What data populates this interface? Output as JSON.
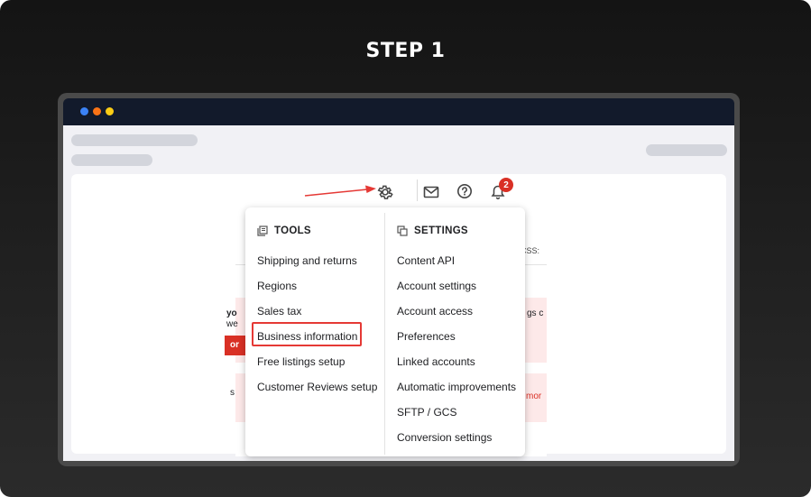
{
  "step": {
    "title": "STEP 1"
  },
  "browser": {
    "dots": [
      {
        "name": "close",
        "color": "#3b82f6"
      },
      {
        "name": "minimize",
        "color": "#f97316"
      },
      {
        "name": "maximize",
        "color": "#facc15"
      }
    ]
  },
  "toolbar": {
    "icons": [
      "gear-icon",
      "mail-icon",
      "help-icon",
      "bell-icon"
    ],
    "notification_count": "2",
    "annotation_color": "#e53935"
  },
  "background_page": {
    "fragment_css": "CSS:",
    "fragment_yo": "yo",
    "fragment_we": "we",
    "fragment_or": "or",
    "fragment_gs": "gs c",
    "fragment_st": "s",
    "fragment_mor": "mor"
  },
  "menu": {
    "tools": {
      "heading": "TOOLS",
      "items": [
        "Shipping and returns",
        "Regions",
        "Sales tax",
        "Business information",
        "Free listings setup",
        "Customer Reviews setup"
      ],
      "highlighted": "Business information"
    },
    "settings": {
      "heading": "SETTINGS",
      "items": [
        "Content API",
        "Account settings",
        "Account access",
        "Preferences",
        "Linked accounts",
        "Automatic improvements",
        "SFTP / GCS",
        "Conversion settings"
      ]
    }
  }
}
